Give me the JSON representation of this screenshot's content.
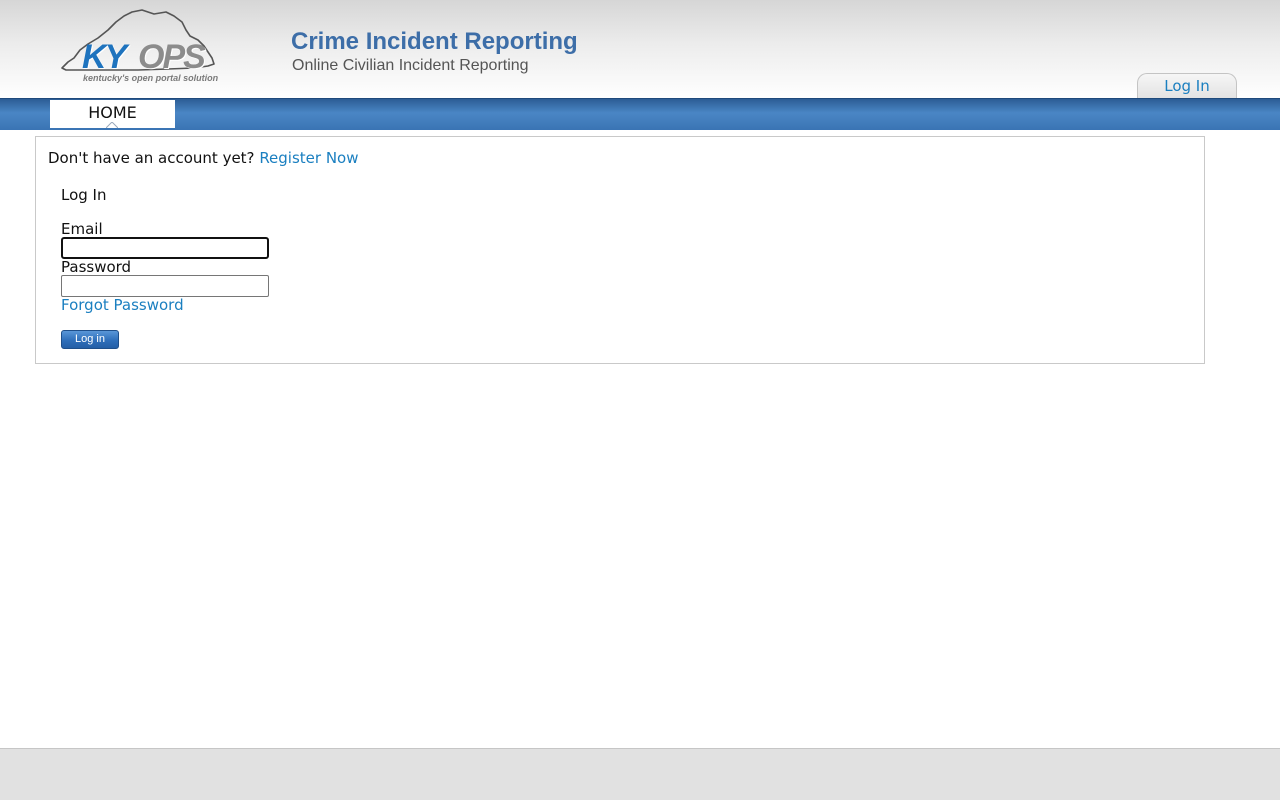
{
  "header": {
    "logo": {
      "ky": "KY",
      "ops": "OPS",
      "tagline": "kentucky's open portal solution"
    },
    "title": "Crime Incident Reporting",
    "subtitle": "Online Civilian Incident Reporting",
    "login_tab": "Log In"
  },
  "nav": {
    "tabs": [
      {
        "label": "HOME",
        "active": true
      }
    ]
  },
  "main": {
    "register_prompt": "Don't have an account yet?",
    "register_link": "Register Now",
    "login_heading": "Log In",
    "email_label": "Email",
    "email_value": "",
    "password_label": "Password",
    "password_value": "",
    "forgot_password": "Forgot Password",
    "login_button": "Log in"
  },
  "colors": {
    "brand_blue": "#3d6ea8",
    "link_blue": "#1a7fc0",
    "nav_blue": "#3a74b4",
    "footer_gray": "#e1e1e1"
  }
}
